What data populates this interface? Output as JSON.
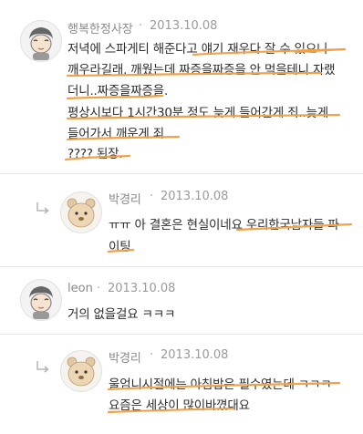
{
  "comments": [
    {
      "author": "행복한정사장",
      "separator": "·",
      "date": "2013.10.08",
      "lines": [
        "저녁에 스파게티 해준다고 얘기 재우다 잘 수 있으니",
        "깨우라길래. 깨웠는데 짜증을짜증을 안 먹을테니 자랬",
        "더니..짜증을짜증을.",
        "평상시보다 1시간30분 정도 늦게 들어간게 죄..늦게",
        "들어가서 깨운게 죄",
        "???? 된장."
      ]
    },
    {
      "author": "박경리",
      "separator": "·",
      "date": "2013.10.08",
      "lines": [
        "ㅠㅠ 아 결혼은 현실이네요 우리한국남자들 파",
        "이팅"
      ]
    },
    {
      "author": "leon",
      "separator": "·",
      "date": "2013.10.08",
      "lines": [
        "거의 없을걸요 ㅋㅋㅋ"
      ]
    },
    {
      "author": "박경리",
      "separator": "·",
      "date": "2013.10.08",
      "lines": [
        "울엄니시절에는 아침밥은 필수였는데 ㅋㅋㅋ",
        "요즘은 세상이 많이바꼈대요"
      ]
    }
  ],
  "colors": {
    "highlight": "#f0a24a",
    "author": "#8a8a8a",
    "text": "#2c2c2c",
    "separator": "#e4e4e4"
  },
  "icons": {
    "reply": "reply-arrow-icon",
    "avatar_cartoon": "cartoon-girl-avatar",
    "avatar_bear": "bear-avatar"
  }
}
